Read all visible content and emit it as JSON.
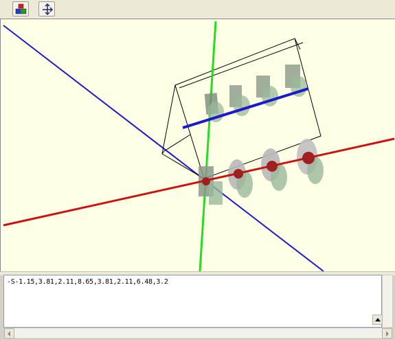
{
  "toolbar": {
    "buttons": [
      {
        "icon": "colored-cubes-icon"
      },
      {
        "icon": "axes-orientation-icon"
      }
    ]
  },
  "viewport": {
    "background": "#ffffe6",
    "axis_colors": {
      "x": "#cc0000",
      "y": "#00cc00",
      "z": "#0000cc"
    }
  },
  "console": {
    "command_text": "-S-1.15,3.81,2.11,8.65,3.81,2.11,6.48,3.2"
  }
}
